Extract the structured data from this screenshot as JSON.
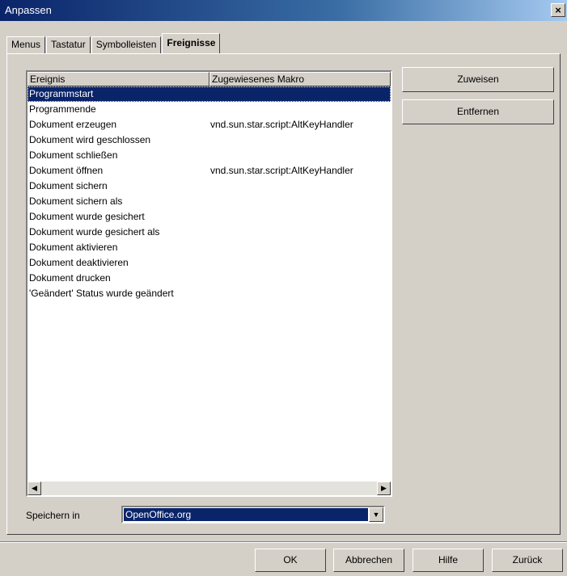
{
  "window": {
    "title": "Anpassen",
    "close_label": "×"
  },
  "tabs": [
    {
      "label": "Menus"
    },
    {
      "label": "Tastatur"
    },
    {
      "label": "Symbolleisten"
    },
    {
      "label": "Freignisse"
    }
  ],
  "events_list": {
    "headers": [
      "Ereignis",
      "Zugewiesenes Makro"
    ],
    "rows": [
      {
        "event": "Programmstart",
        "macro": ""
      },
      {
        "event": "Programmende",
        "macro": ""
      },
      {
        "event": "Dokument erzeugen",
        "macro": "vnd.sun.star.script:AltKeyHandler"
      },
      {
        "event": "Dokument wird geschlossen",
        "macro": ""
      },
      {
        "event": "Dokument schließen",
        "macro": ""
      },
      {
        "event": "Dokument öffnen",
        "macro": "vnd.sun.star.script:AltKeyHandler"
      },
      {
        "event": "Dokument sichern",
        "macro": ""
      },
      {
        "event": "Dokument sichern als",
        "macro": ""
      },
      {
        "event": "Dokument wurde gesichert",
        "macro": ""
      },
      {
        "event": "Dokument wurde gesichert als",
        "macro": ""
      },
      {
        "event": "Dokument aktivieren",
        "macro": ""
      },
      {
        "event": "Dokument deaktivieren",
        "macro": ""
      },
      {
        "event": "Dokument drucken",
        "macro": ""
      },
      {
        "event": "'Geändert' Status wurde geändert",
        "macro": ""
      }
    ],
    "scroll_left": "◀",
    "scroll_right": "▶"
  },
  "side_buttons": {
    "assign": "Zuweisen",
    "remove": "Entfernen"
  },
  "save_in": {
    "label": "Speichern in",
    "value": "OpenOffice.org",
    "dropdown_glyph": "▼"
  },
  "footer": {
    "ok": "OK",
    "cancel": "Abbrechen",
    "help": "Hilfe",
    "reset": "Zurück"
  },
  "colors": {
    "face": "#d4d0c8",
    "selection": "#0a246a",
    "title_start": "#0a246a",
    "title_end": "#a6caf0"
  }
}
